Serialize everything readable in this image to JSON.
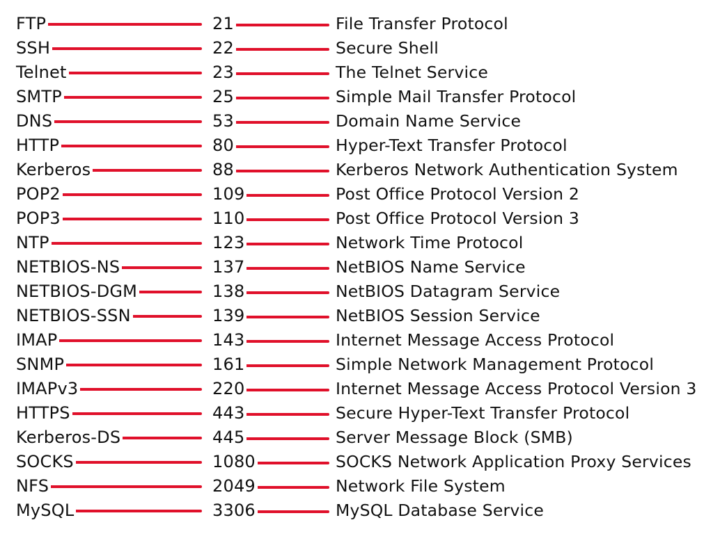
{
  "colors": {
    "line": "#e0102a",
    "text": "#111111",
    "background": "#ffffff"
  },
  "rows": [
    {
      "protocol": "FTP",
      "port": "21",
      "description": "File Transfer Protocol"
    },
    {
      "protocol": "SSH",
      "port": "22",
      "description": "Secure Shell"
    },
    {
      "protocol": "Telnet",
      "port": "23",
      "description": "The Telnet Service"
    },
    {
      "protocol": "SMTP",
      "port": "25",
      "description": "Simple Mail Transfer Protocol"
    },
    {
      "protocol": "DNS",
      "port": "53",
      "description": "Domain Name Service"
    },
    {
      "protocol": "HTTP",
      "port": "80",
      "description": "Hyper-Text Transfer Protocol"
    },
    {
      "protocol": "Kerberos",
      "port": "88",
      "description": "Kerberos Network Authentication System"
    },
    {
      "protocol": "POP2",
      "port": "109",
      "description": "Post Office Protocol Version 2"
    },
    {
      "protocol": "POP3",
      "port": "110",
      "description": "Post Office Protocol Version 3"
    },
    {
      "protocol": "NTP",
      "port": "123",
      "description": "Network Time Protocol"
    },
    {
      "protocol": "NETBIOS-NS",
      "port": "137",
      "description": "NetBIOS Name Service"
    },
    {
      "protocol": "NETBIOS-DGM",
      "port": "138",
      "description": "NetBIOS Datagram Service"
    },
    {
      "protocol": "NETBIOS-SSN",
      "port": "139",
      "description": "NetBIOS Session Service"
    },
    {
      "protocol": "IMAP",
      "port": "143",
      "description": "Internet Message Access Protocol"
    },
    {
      "protocol": "SNMP",
      "port": "161",
      "description": "Simple Network Management Protocol"
    },
    {
      "protocol": "IMAPv3",
      "port": "220",
      "description": "Internet Message Access Protocol Version 3"
    },
    {
      "protocol": "HTTPS",
      "port": "443",
      "description": "Secure Hyper-Text Transfer Protocol"
    },
    {
      "protocol": "Kerberos-DS",
      "port": "445",
      "description": "Server Message Block (SMB)"
    },
    {
      "protocol": "SOCKS",
      "port": "1080",
      "description": "SOCKS Network Application Proxy Services"
    },
    {
      "protocol": "NFS",
      "port": "2049",
      "description": "Network File System"
    },
    {
      "protocol": "MySQL",
      "port": "3306",
      "description": "MySQL Database Service"
    }
  ]
}
